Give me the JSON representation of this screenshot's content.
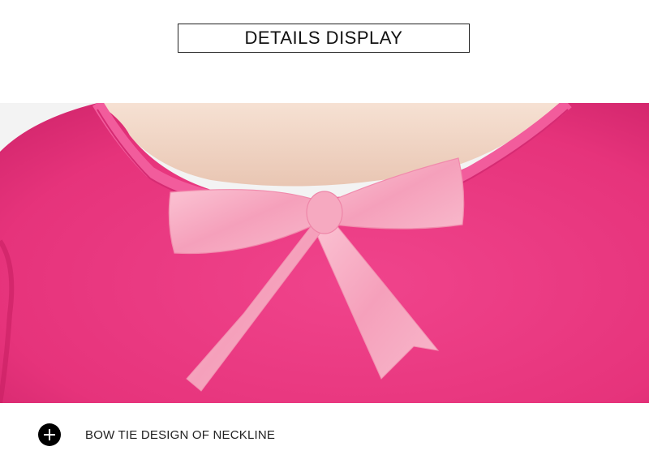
{
  "header": {
    "title": "DETAILS DISPLAY"
  },
  "photo": {
    "subject": "pink top neckline with satin bow"
  },
  "caption": {
    "icon": "plus-icon",
    "text": "BOW TIE DESIGN OF NECKLINE"
  },
  "colors": {
    "fabric": "#e8357f",
    "skin": "#f2d6c6",
    "ribbon": "#f6a3bd"
  }
}
